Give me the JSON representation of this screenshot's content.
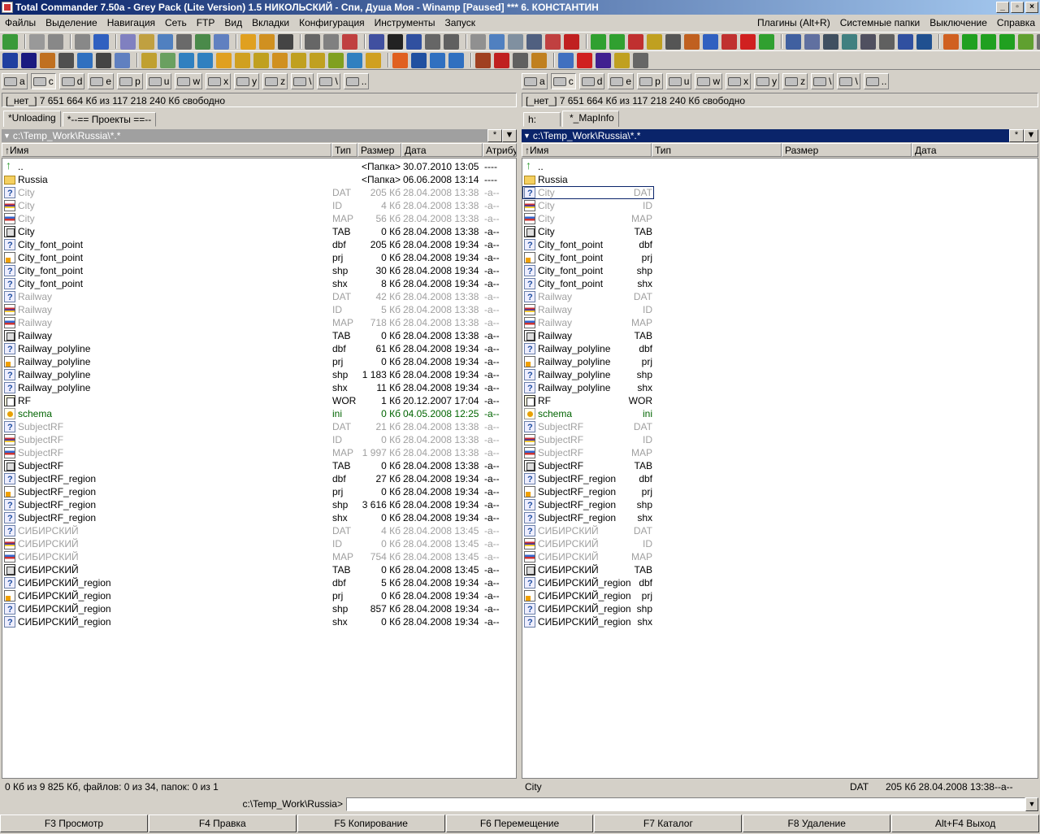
{
  "window": {
    "title": "Total Commander 7.50a - Grey Pack  (Lite Version) 1.5  НИКОЛЬСКИЙ - Спи, Душа Моя - Winamp [Paused] *** 6. КОНСТАНТИН",
    "min": "_",
    "max": "▫",
    "close": "×"
  },
  "menu": {
    "left": [
      "Файлы",
      "Выделение",
      "Навигация",
      "Сеть",
      "FTP",
      "Вид",
      "Вкладки",
      "Конфигурация",
      "Инструменты",
      "Запуск"
    ],
    "right": [
      "Плагины (Alt+R)",
      "Системные папки",
      "Выключение",
      "Справка"
    ]
  },
  "toolbar_colors": {
    "row1": [
      "#3a9a3a",
      "#999",
      "#888",
      "#888",
      "#3060c0",
      "#8080c0",
      "#c0a040",
      "#5080c0",
      "#6a6a6a",
      "#4a8a4a",
      "#6080c0",
      "#e0a020",
      "#d09020",
      "#444",
      "#666",
      "#808080",
      "#c04040",
      "#4050a0",
      "#222",
      "#3050a0",
      "#666",
      "#606060",
      "#909090",
      "#5080c0",
      "#8090a0",
      "#506080",
      "#c04040",
      "#c02020",
      "#30a030",
      "#30a030",
      "#c03030",
      "#c0a020",
      "#555",
      "#c06020",
      "#3060c0",
      "#c03030",
      "#d02020",
      "#30a030",
      "#4060a0",
      "#6070a0",
      "#405060",
      "#408080",
      "#505060",
      "#606060",
      "#3050a0",
      "#205090",
      "#d06020",
      "#20a020",
      "#20a020",
      "#20a020",
      "#60a030",
      "#707070"
    ],
    "row2": [
      "#2040a0",
      "#1a1a80",
      "#c07020",
      "#505050",
      "#3070c0",
      "#444",
      "#6080c0",
      "#c0a030",
      "#6aa060",
      "#3080c0",
      "#3080c0",
      "#e0a020",
      "#d0a020",
      "#c0a020",
      "#d09020",
      "#c0a020",
      "#c0a020",
      "#80a020",
      "#3080c0",
      "#d0a020",
      "#e06020",
      "#2050a0",
      "#3070c0",
      "#3070c0",
      "#a04020",
      "#c02020",
      "#606060",
      "#c08020",
      "#4070c0",
      "#d02020",
      "#402090",
      "#c0a020",
      "#666"
    ]
  },
  "drives": [
    "a",
    "c",
    "d",
    "e",
    "p",
    "u",
    "w",
    "x",
    "y",
    "z",
    "\\",
    "\\",
    ".."
  ],
  "left": {
    "free": "[_нет_]  7 651 664 Кб из 117 218 240 Кб свободно",
    "tabs": [
      "*Unloading",
      "*--== Проекты ==--"
    ],
    "path": "c:\\Temp_Work\\Russia\\*.*",
    "star": "*",
    "down": "▼",
    "cols": [
      "↑Имя",
      "Тип",
      "Размер",
      "Дата",
      "Атрибуты"
    ],
    "status": "0 Кб из 9 825 Кб, файлов: 0 из 34, папок: 0 из 1"
  },
  "right": {
    "free": "[_нет_]  7 651 664 Кб из 117 218 240 Кб свободно",
    "tabs": [
      "h:",
      "*_MapInfo"
    ],
    "path": "c:\\Temp_Work\\Russia\\*.*",
    "star": "*",
    "down": "▼",
    "cols": [
      "↑Имя",
      "Тип",
      "Размер",
      "Дата"
    ],
    "status": {
      "name": "City",
      "type": "DAT",
      "info": "205 Кб 28.04.2008 13:38--a--"
    }
  },
  "files": [
    {
      "n": "..",
      "t": "",
      "s": "<Папка>",
      "d": "30.07.2010 13:05",
      "a": "----",
      "c": "#000",
      "i": "up"
    },
    {
      "n": "Russia",
      "t": "",
      "s": "<Папка>",
      "d": "06.06.2008 13:14",
      "a": "----",
      "c": "#000",
      "i": "folder"
    },
    {
      "n": "City",
      "t": "DAT",
      "s": "205 Кб",
      "d": "28.04.2008 13:38",
      "a": "-a--",
      "c": "#a0a0a0",
      "i": "q"
    },
    {
      "n": "City",
      "t": "ID",
      "s": "4 Кб",
      "d": "28.04.2008 13:38",
      "a": "-a--",
      "c": "#a0a0a0",
      "i": "id"
    },
    {
      "n": "City",
      "t": "MAP",
      "s": "56 Кб",
      "d": "28.04.2008 13:38",
      "a": "-a--",
      "c": "#a0a0a0",
      "i": "map"
    },
    {
      "n": "City",
      "t": "TAB",
      "s": "0 Кб",
      "d": "28.04.2008 13:38",
      "a": "-a--",
      "c": "#000",
      "i": "tab"
    },
    {
      "n": "City_font_point",
      "t": "dbf",
      "s": "205 Кб",
      "d": "28.04.2008 19:34",
      "a": "-a--",
      "c": "#000",
      "i": "q"
    },
    {
      "n": "City_font_point",
      "t": "prj",
      "s": "0 Кб",
      "d": "28.04.2008 19:34",
      "a": "-a--",
      "c": "#000",
      "i": "prj"
    },
    {
      "n": "City_font_point",
      "t": "shp",
      "s": "30 Кб",
      "d": "28.04.2008 19:34",
      "a": "-a--",
      "c": "#000",
      "i": "q"
    },
    {
      "n": "City_font_point",
      "t": "shx",
      "s": "8 Кб",
      "d": "28.04.2008 19:34",
      "a": "-a--",
      "c": "#000",
      "i": "q"
    },
    {
      "n": "Railway",
      "t": "DAT",
      "s": "42 Кб",
      "d": "28.04.2008 13:38",
      "a": "-a--",
      "c": "#a0a0a0",
      "i": "q"
    },
    {
      "n": "Railway",
      "t": "ID",
      "s": "5 Кб",
      "d": "28.04.2008 13:38",
      "a": "-a--",
      "c": "#a0a0a0",
      "i": "id"
    },
    {
      "n": "Railway",
      "t": "MAP",
      "s": "718 Кб",
      "d": "28.04.2008 13:38",
      "a": "-a--",
      "c": "#a0a0a0",
      "i": "map"
    },
    {
      "n": "Railway",
      "t": "TAB",
      "s": "0 Кб",
      "d": "28.04.2008 13:38",
      "a": "-a--",
      "c": "#000",
      "i": "tab"
    },
    {
      "n": "Railway_polyline",
      "t": "dbf",
      "s": "61 Кб",
      "d": "28.04.2008 19:34",
      "a": "-a--",
      "c": "#000",
      "i": "q"
    },
    {
      "n": "Railway_polyline",
      "t": "prj",
      "s": "0 Кб",
      "d": "28.04.2008 19:34",
      "a": "-a--",
      "c": "#000",
      "i": "prj"
    },
    {
      "n": "Railway_polyline",
      "t": "shp",
      "s": "1 183 Кб",
      "d": "28.04.2008 19:34",
      "a": "-a--",
      "c": "#000",
      "i": "q"
    },
    {
      "n": "Railway_polyline",
      "t": "shx",
      "s": "11 Кб",
      "d": "28.04.2008 19:34",
      "a": "-a--",
      "c": "#000",
      "i": "q"
    },
    {
      "n": "RF",
      "t": "WOR",
      "s": "1 Кб",
      "d": "20.12.2007 17:04",
      "a": "-a--",
      "c": "#000",
      "i": "wor"
    },
    {
      "n": "schema",
      "t": "ini",
      "s": "0 Кб",
      "d": "04.05.2008 12:25",
      "a": "-a--",
      "c": "#006400",
      "i": "ini"
    },
    {
      "n": "SubjectRF",
      "t": "DAT",
      "s": "21 Кб",
      "d": "28.04.2008 13:38",
      "a": "-a--",
      "c": "#a0a0a0",
      "i": "q"
    },
    {
      "n": "SubjectRF",
      "t": "ID",
      "s": "0 Кб",
      "d": "28.04.2008 13:38",
      "a": "-a--",
      "c": "#a0a0a0",
      "i": "id"
    },
    {
      "n": "SubjectRF",
      "t": "MAP",
      "s": "1 997 Кб",
      "d": "28.04.2008 13:38",
      "a": "-a--",
      "c": "#a0a0a0",
      "i": "map"
    },
    {
      "n": "SubjectRF",
      "t": "TAB",
      "s": "0 Кб",
      "d": "28.04.2008 13:38",
      "a": "-a--",
      "c": "#000",
      "i": "tab"
    },
    {
      "n": "SubjectRF_region",
      "t": "dbf",
      "s": "27 Кб",
      "d": "28.04.2008 19:34",
      "a": "-a--",
      "c": "#000",
      "i": "q"
    },
    {
      "n": "SubjectRF_region",
      "t": "prj",
      "s": "0 Кб",
      "d": "28.04.2008 19:34",
      "a": "-a--",
      "c": "#000",
      "i": "prj"
    },
    {
      "n": "SubjectRF_region",
      "t": "shp",
      "s": "3 616 Кб",
      "d": "28.04.2008 19:34",
      "a": "-a--",
      "c": "#000",
      "i": "q"
    },
    {
      "n": "SubjectRF_region",
      "t": "shx",
      "s": "0 Кб",
      "d": "28.04.2008 19:34",
      "a": "-a--",
      "c": "#000",
      "i": "q"
    },
    {
      "n": "СИБИРСКИЙ",
      "t": "DAT",
      "s": "4 Кб",
      "d": "28.04.2008 13:45",
      "a": "-a--",
      "c": "#a0a0a0",
      "i": "q"
    },
    {
      "n": "СИБИРСКИЙ",
      "t": "ID",
      "s": "0 Кб",
      "d": "28.04.2008 13:45",
      "a": "-a--",
      "c": "#a0a0a0",
      "i": "id"
    },
    {
      "n": "СИБИРСКИЙ",
      "t": "MAP",
      "s": "754 Кб",
      "d": "28.04.2008 13:45",
      "a": "-a--",
      "c": "#a0a0a0",
      "i": "map"
    },
    {
      "n": "СИБИРСКИЙ",
      "t": "TAB",
      "s": "0 Кб",
      "d": "28.04.2008 13:45",
      "a": "-a--",
      "c": "#000",
      "i": "tab"
    },
    {
      "n": "СИБИРСКИЙ_region",
      "t": "dbf",
      "s": "5 Кб",
      "d": "28.04.2008 19:34",
      "a": "-a--",
      "c": "#000",
      "i": "q"
    },
    {
      "n": "СИБИРСКИЙ_region",
      "t": "prj",
      "s": "0 Кб",
      "d": "28.04.2008 19:34",
      "a": "-a--",
      "c": "#000",
      "i": "prj"
    },
    {
      "n": "СИБИРСКИЙ_region",
      "t": "shp",
      "s": "857 Кб",
      "d": "28.04.2008 19:34",
      "a": "-a--",
      "c": "#000",
      "i": "q"
    },
    {
      "n": "СИБИРСКИЙ_region",
      "t": "shx",
      "s": "0 Кб",
      "d": "28.04.2008 19:34",
      "a": "-a--",
      "c": "#000",
      "i": "q"
    }
  ],
  "cmd": {
    "label": "c:\\Temp_Work\\Russia>",
    "value": "",
    "dd": "▼"
  },
  "fkeys": [
    "F3 Просмотр",
    "F4 Правка",
    "F5 Копирование",
    "F6 Перемещение",
    "F7 Каталог",
    "F8 Удаление",
    "Alt+F4 Выход"
  ]
}
